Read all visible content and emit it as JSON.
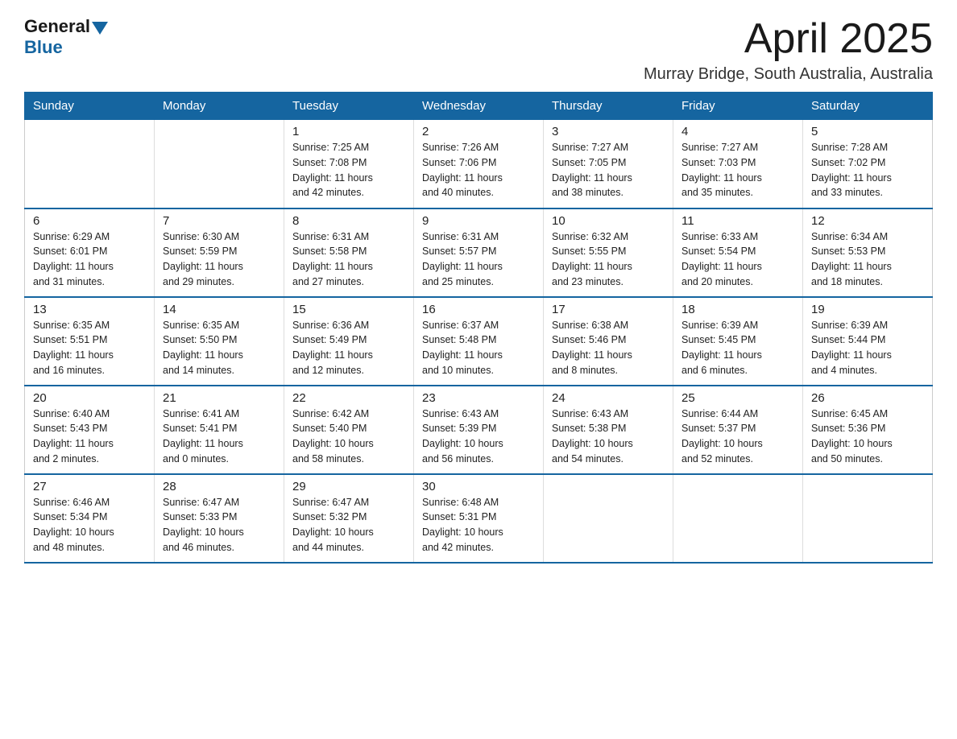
{
  "header": {
    "logo_general": "General",
    "logo_blue": "Blue",
    "month_title": "April 2025",
    "location": "Murray Bridge, South Australia, Australia"
  },
  "days_of_week": [
    "Sunday",
    "Monday",
    "Tuesday",
    "Wednesday",
    "Thursday",
    "Friday",
    "Saturday"
  ],
  "weeks": [
    [
      {
        "num": "",
        "info": ""
      },
      {
        "num": "",
        "info": ""
      },
      {
        "num": "1",
        "info": "Sunrise: 7:25 AM\nSunset: 7:08 PM\nDaylight: 11 hours\nand 42 minutes."
      },
      {
        "num": "2",
        "info": "Sunrise: 7:26 AM\nSunset: 7:06 PM\nDaylight: 11 hours\nand 40 minutes."
      },
      {
        "num": "3",
        "info": "Sunrise: 7:27 AM\nSunset: 7:05 PM\nDaylight: 11 hours\nand 38 minutes."
      },
      {
        "num": "4",
        "info": "Sunrise: 7:27 AM\nSunset: 7:03 PM\nDaylight: 11 hours\nand 35 minutes."
      },
      {
        "num": "5",
        "info": "Sunrise: 7:28 AM\nSunset: 7:02 PM\nDaylight: 11 hours\nand 33 minutes."
      }
    ],
    [
      {
        "num": "6",
        "info": "Sunrise: 6:29 AM\nSunset: 6:01 PM\nDaylight: 11 hours\nand 31 minutes."
      },
      {
        "num": "7",
        "info": "Sunrise: 6:30 AM\nSunset: 5:59 PM\nDaylight: 11 hours\nand 29 minutes."
      },
      {
        "num": "8",
        "info": "Sunrise: 6:31 AM\nSunset: 5:58 PM\nDaylight: 11 hours\nand 27 minutes."
      },
      {
        "num": "9",
        "info": "Sunrise: 6:31 AM\nSunset: 5:57 PM\nDaylight: 11 hours\nand 25 minutes."
      },
      {
        "num": "10",
        "info": "Sunrise: 6:32 AM\nSunset: 5:55 PM\nDaylight: 11 hours\nand 23 minutes."
      },
      {
        "num": "11",
        "info": "Sunrise: 6:33 AM\nSunset: 5:54 PM\nDaylight: 11 hours\nand 20 minutes."
      },
      {
        "num": "12",
        "info": "Sunrise: 6:34 AM\nSunset: 5:53 PM\nDaylight: 11 hours\nand 18 minutes."
      }
    ],
    [
      {
        "num": "13",
        "info": "Sunrise: 6:35 AM\nSunset: 5:51 PM\nDaylight: 11 hours\nand 16 minutes."
      },
      {
        "num": "14",
        "info": "Sunrise: 6:35 AM\nSunset: 5:50 PM\nDaylight: 11 hours\nand 14 minutes."
      },
      {
        "num": "15",
        "info": "Sunrise: 6:36 AM\nSunset: 5:49 PM\nDaylight: 11 hours\nand 12 minutes."
      },
      {
        "num": "16",
        "info": "Sunrise: 6:37 AM\nSunset: 5:48 PM\nDaylight: 11 hours\nand 10 minutes."
      },
      {
        "num": "17",
        "info": "Sunrise: 6:38 AM\nSunset: 5:46 PM\nDaylight: 11 hours\nand 8 minutes."
      },
      {
        "num": "18",
        "info": "Sunrise: 6:39 AM\nSunset: 5:45 PM\nDaylight: 11 hours\nand 6 minutes."
      },
      {
        "num": "19",
        "info": "Sunrise: 6:39 AM\nSunset: 5:44 PM\nDaylight: 11 hours\nand 4 minutes."
      }
    ],
    [
      {
        "num": "20",
        "info": "Sunrise: 6:40 AM\nSunset: 5:43 PM\nDaylight: 11 hours\nand 2 minutes."
      },
      {
        "num": "21",
        "info": "Sunrise: 6:41 AM\nSunset: 5:41 PM\nDaylight: 11 hours\nand 0 minutes."
      },
      {
        "num": "22",
        "info": "Sunrise: 6:42 AM\nSunset: 5:40 PM\nDaylight: 10 hours\nand 58 minutes."
      },
      {
        "num": "23",
        "info": "Sunrise: 6:43 AM\nSunset: 5:39 PM\nDaylight: 10 hours\nand 56 minutes."
      },
      {
        "num": "24",
        "info": "Sunrise: 6:43 AM\nSunset: 5:38 PM\nDaylight: 10 hours\nand 54 minutes."
      },
      {
        "num": "25",
        "info": "Sunrise: 6:44 AM\nSunset: 5:37 PM\nDaylight: 10 hours\nand 52 minutes."
      },
      {
        "num": "26",
        "info": "Sunrise: 6:45 AM\nSunset: 5:36 PM\nDaylight: 10 hours\nand 50 minutes."
      }
    ],
    [
      {
        "num": "27",
        "info": "Sunrise: 6:46 AM\nSunset: 5:34 PM\nDaylight: 10 hours\nand 48 minutes."
      },
      {
        "num": "28",
        "info": "Sunrise: 6:47 AM\nSunset: 5:33 PM\nDaylight: 10 hours\nand 46 minutes."
      },
      {
        "num": "29",
        "info": "Sunrise: 6:47 AM\nSunset: 5:32 PM\nDaylight: 10 hours\nand 44 minutes."
      },
      {
        "num": "30",
        "info": "Sunrise: 6:48 AM\nSunset: 5:31 PM\nDaylight: 10 hours\nand 42 minutes."
      },
      {
        "num": "",
        "info": ""
      },
      {
        "num": "",
        "info": ""
      },
      {
        "num": "",
        "info": ""
      }
    ]
  ]
}
